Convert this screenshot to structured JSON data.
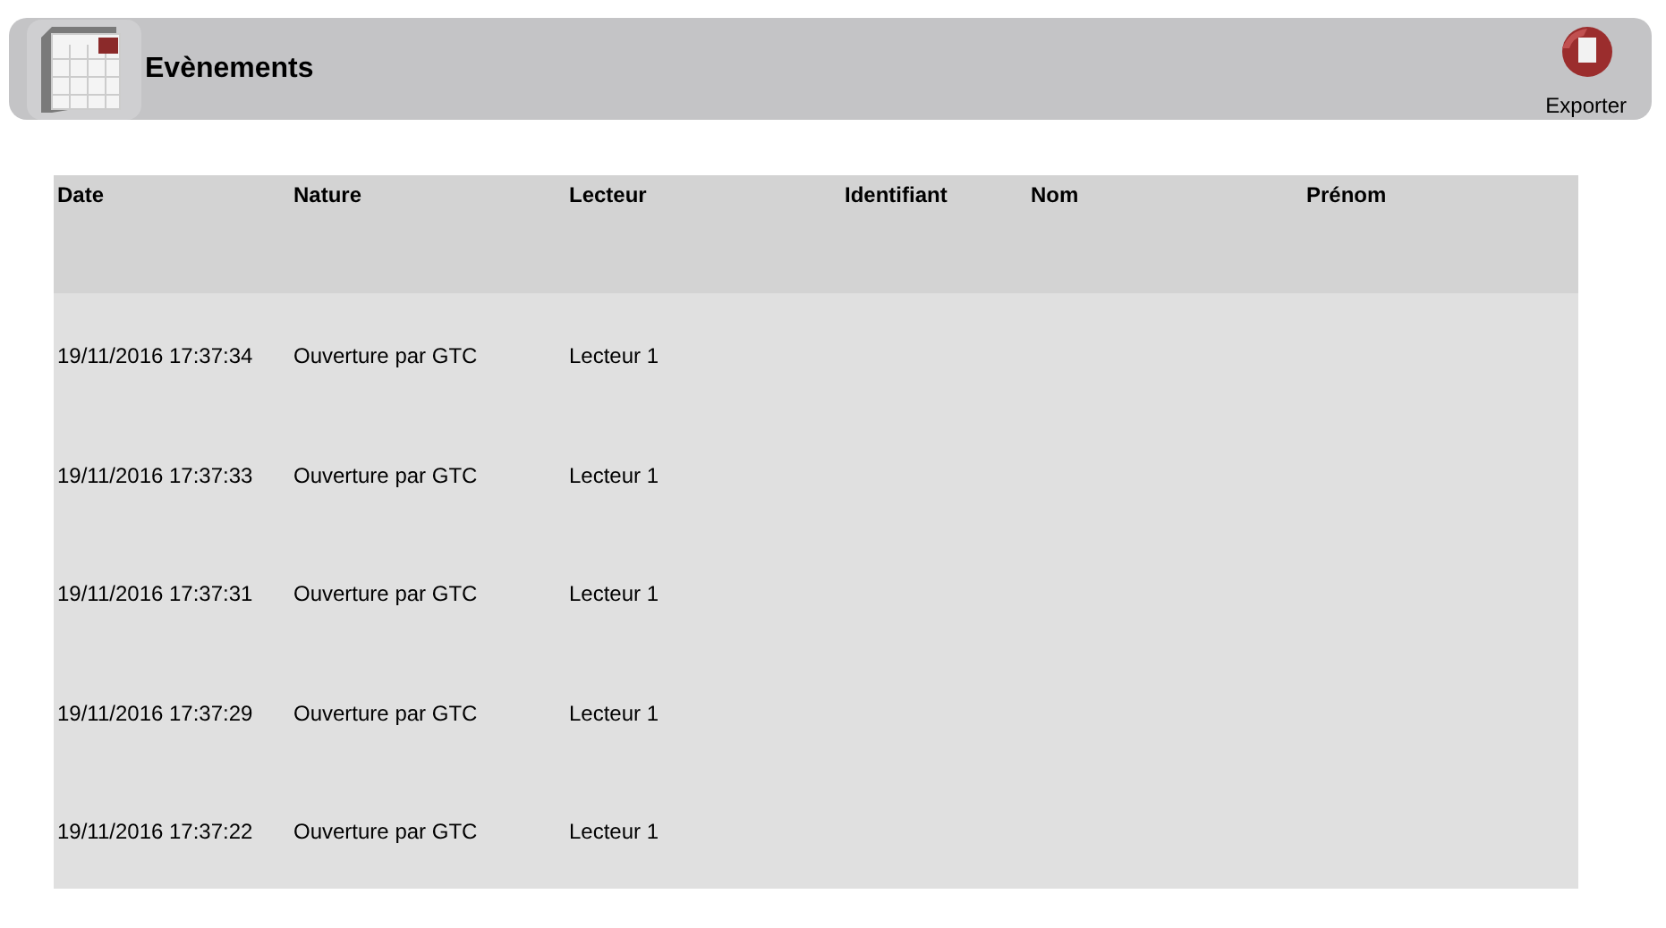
{
  "header": {
    "title": "Evènements",
    "export_label": "Exporter"
  },
  "table": {
    "columns": [
      "Date",
      "Nature",
      "Lecteur",
      "Identifiant",
      "Nom",
      "Prénom"
    ],
    "rows": [
      [
        "19/11/2016 17:37:34",
        "Ouverture par GTC",
        "Lecteur 1"
      ],
      [
        "19/11/2016 17:37:33",
        "Ouverture par GTC",
        "Lecteur 1"
      ],
      [
        "19/11/2016 17:37:31",
        "Ouverture par GTC",
        "Lecteur 1"
      ],
      [
        "19/11/2016 17:37:29",
        "Ouverture par GTC",
        "Lecteur 1"
      ],
      [
        "19/11/2016 17:37:22",
        "Ouverture par GTC",
        "Lecteur 1"
      ]
    ]
  }
}
